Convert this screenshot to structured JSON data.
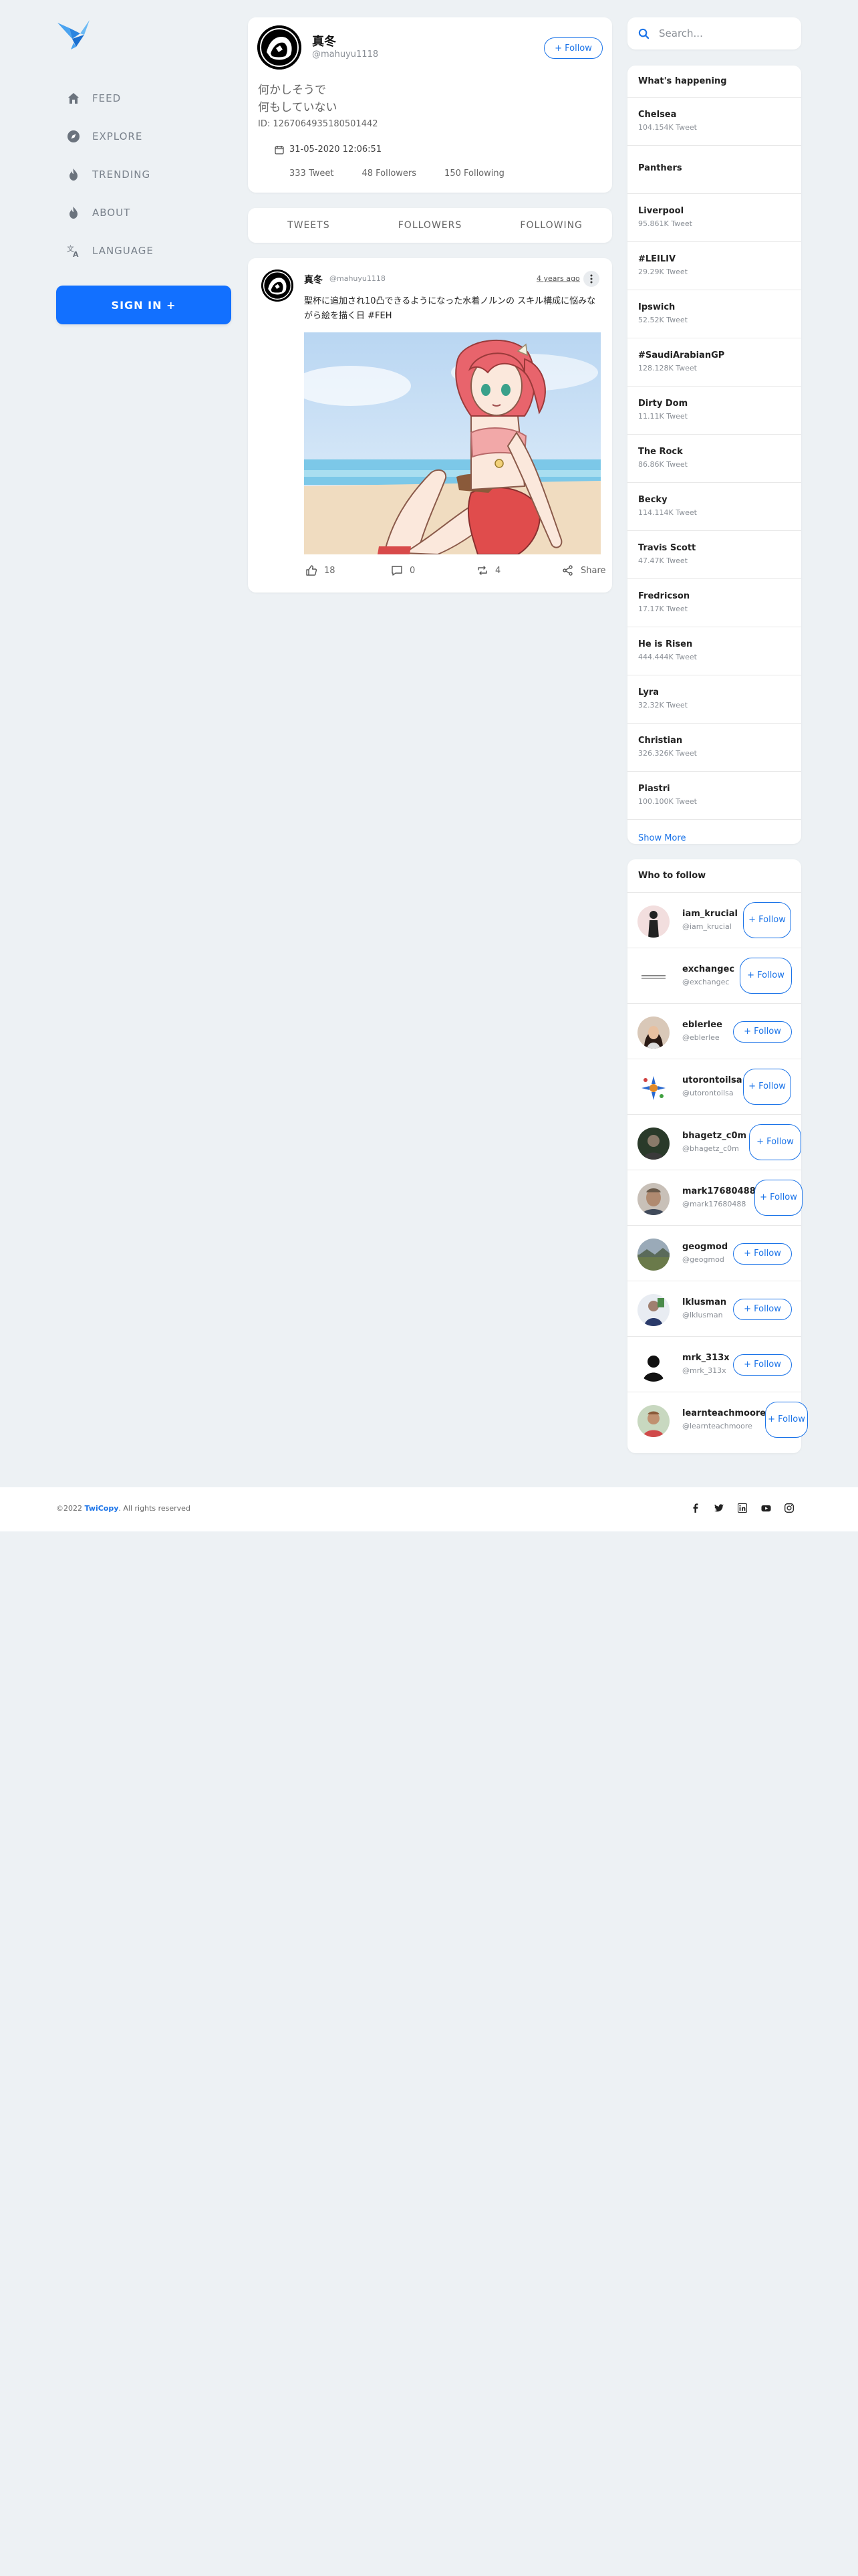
{
  "sidebar": {
    "logo_icon": "bird-logo",
    "items": [
      {
        "label": "FEED",
        "icon": "home-icon"
      },
      {
        "label": "EXPLORE",
        "icon": "compass-icon"
      },
      {
        "label": "TRENDING",
        "icon": "flame-icon"
      },
      {
        "label": "ABOUT",
        "icon": "flame-icon"
      },
      {
        "label": "LANGUAGE",
        "icon": "translate-icon"
      }
    ],
    "signin_label": "SIGN IN +"
  },
  "profile": {
    "name": "真冬",
    "handle": "@mahuyu1118",
    "follow_label": "+ Follow",
    "bio_line1": "何かしそうで",
    "bio_line2": "何もしていない",
    "id_text": "ID: 1267064935180501442",
    "joined": "31-05-2020 12:06:51",
    "tweets": "333 Tweet",
    "followers": "48 Followers",
    "following": "150 Following"
  },
  "tabs": [
    "TWEETS",
    "FOLLOWERS",
    "FOLLOWING"
  ],
  "tweet": {
    "name": "真冬",
    "handle": "@mahuyu1118",
    "time": "4 years ago",
    "text": "聖杯に追加され10凸できるようになった水着ノルンの スキル構成に悩みながら絵を描く日 #FEH",
    "likes": "18",
    "comments": "0",
    "retweets": "4",
    "share_label": "Share"
  },
  "search": {
    "placeholder": "Search..."
  },
  "happening": {
    "title": "What's happening",
    "trends": [
      {
        "name": "Chelsea",
        "count": "104.154K Tweet"
      },
      {
        "name": "Panthers",
        "count": ""
      },
      {
        "name": "Liverpool",
        "count": "95.861K Tweet"
      },
      {
        "name": "#LEILIV",
        "count": "29.29K Tweet"
      },
      {
        "name": "Ipswich",
        "count": "52.52K Tweet"
      },
      {
        "name": "#SaudiArabianGP",
        "count": "128.128K Tweet"
      },
      {
        "name": "Dirty Dom",
        "count": "11.11K Tweet"
      },
      {
        "name": "The Rock",
        "count": "86.86K Tweet"
      },
      {
        "name": "Becky",
        "count": "114.114K Tweet"
      },
      {
        "name": "Travis Scott",
        "count": "47.47K Tweet"
      },
      {
        "name": "Fredricson",
        "count": "17.17K Tweet"
      },
      {
        "name": "He is Risen",
        "count": "444.444K Tweet"
      },
      {
        "name": "Lyra",
        "count": "32.32K Tweet"
      },
      {
        "name": "Christian",
        "count": "326.326K Tweet"
      },
      {
        "name": "Piastri",
        "count": "100.100K Tweet"
      }
    ],
    "show_more": "Show More"
  },
  "who_to_follow": {
    "title": "Who to follow",
    "follow_label": "+ Follow",
    "users": [
      {
        "name": "iam_krucial",
        "handle": "@iam_krucial"
      },
      {
        "name": "exchangec",
        "handle": "@exchangec"
      },
      {
        "name": "eblerlee",
        "handle": "@eblerlee"
      },
      {
        "name": "utorontoilsa",
        "handle": "@utorontoilsa"
      },
      {
        "name": "bhagetz_c0m",
        "handle": "@bhagetz_c0m"
      },
      {
        "name": "mark17680488",
        "handle": "@mark17680488"
      },
      {
        "name": "geogmod",
        "handle": "@geogmod"
      },
      {
        "name": "lklusman",
        "handle": "@lklusman"
      },
      {
        "name": "mrk_313x",
        "handle": "@mrk_313x"
      },
      {
        "name": "learnteachmoore",
        "handle": "@learnteachmoore"
      }
    ]
  },
  "footer": {
    "copy_prefix": "©2022 ",
    "brand": "TwiCopy",
    "copy_suffix": ". All rights reserved",
    "social": [
      "facebook-icon",
      "twitter-icon",
      "linkedin-icon",
      "youtube-icon",
      "instagram-icon"
    ]
  },
  "colors": {
    "accent": "#1a73e8",
    "signin": "#1270ff",
    "background": "#edf1f4"
  }
}
